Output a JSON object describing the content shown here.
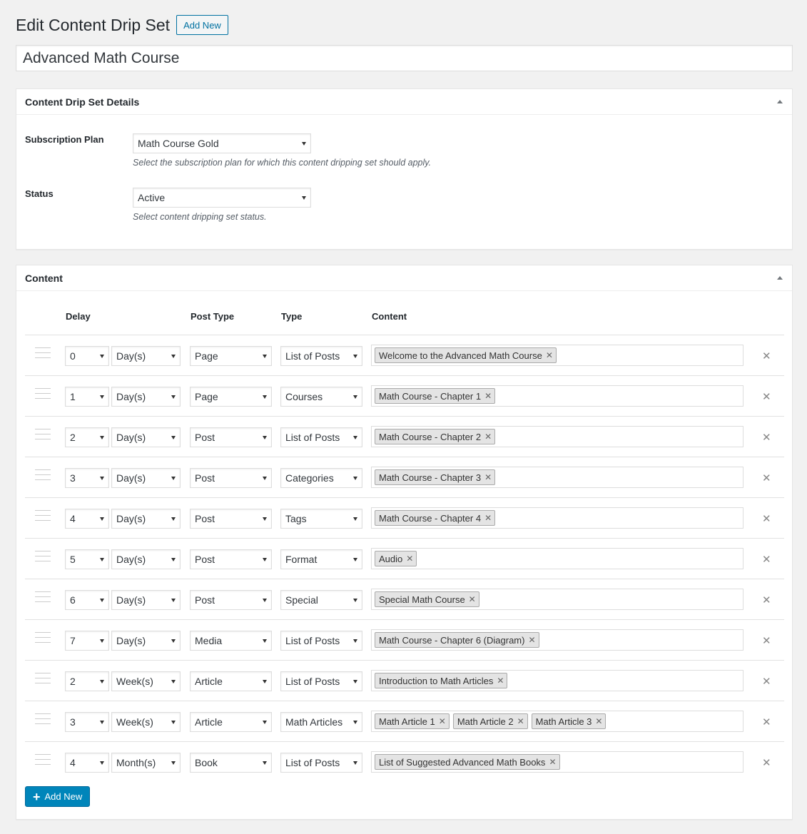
{
  "header": {
    "title": "Edit Content Drip Set",
    "add_new": "Add New"
  },
  "title_value": "Advanced Math Course",
  "details": {
    "title": "Content Drip Set Details",
    "plan_label": "Subscription Plan",
    "plan_value": "Math Course Gold",
    "plan_help": "Select the subscription plan for which this content dripping set should apply.",
    "status_label": "Status",
    "status_value": "Active",
    "status_help": "Select content dripping set status."
  },
  "content": {
    "title": "Content",
    "headers": {
      "delay": "Delay",
      "post_type": "Post Type",
      "type": "Type",
      "content": "Content"
    },
    "rows": [
      {
        "delay": "0",
        "unit": "Day(s)",
        "post_type": "Page",
        "type": "List of Posts",
        "tags": [
          "Welcome to the Advanced Math Course"
        ]
      },
      {
        "delay": "1",
        "unit": "Day(s)",
        "post_type": "Page",
        "type": "Courses",
        "tags": [
          "Math Course - Chapter 1"
        ]
      },
      {
        "delay": "2",
        "unit": "Day(s)",
        "post_type": "Post",
        "type": "List of Posts",
        "tags": [
          "Math Course - Chapter 2"
        ]
      },
      {
        "delay": "3",
        "unit": "Day(s)",
        "post_type": "Post",
        "type": "Categories",
        "tags": [
          "Math Course - Chapter 3"
        ]
      },
      {
        "delay": "4",
        "unit": "Day(s)",
        "post_type": "Post",
        "type": "Tags",
        "tags": [
          "Math Course - Chapter 4"
        ]
      },
      {
        "delay": "5",
        "unit": "Day(s)",
        "post_type": "Post",
        "type": "Format",
        "tags": [
          "Audio"
        ]
      },
      {
        "delay": "6",
        "unit": "Day(s)",
        "post_type": "Post",
        "type": "Special",
        "tags": [
          "Special Math Course"
        ]
      },
      {
        "delay": "7",
        "unit": "Day(s)",
        "post_type": "Media",
        "type": "List of Posts",
        "tags": [
          "Math Course - Chapter 6 (Diagram)"
        ]
      },
      {
        "delay": "2",
        "unit": "Week(s)",
        "post_type": "Article",
        "type": "List of Posts",
        "tags": [
          "Introduction to Math Articles"
        ]
      },
      {
        "delay": "3",
        "unit": "Week(s)",
        "post_type": "Article",
        "type": "Math Articles",
        "tags": [
          "Math Article 1",
          "Math Article 2",
          "Math Article 3"
        ]
      },
      {
        "delay": "4",
        "unit": "Month(s)",
        "post_type": "Book",
        "type": "List of Posts",
        "tags": [
          "List of Suggested Advanced Math Books"
        ]
      }
    ],
    "add_new": "Add New"
  }
}
